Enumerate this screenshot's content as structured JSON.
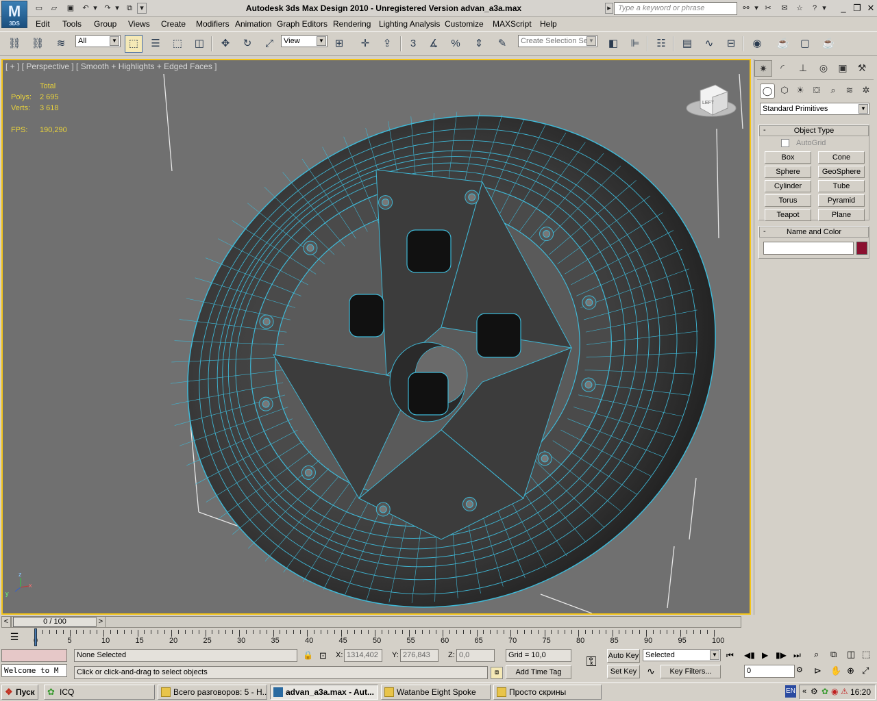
{
  "window": {
    "title": "Autodesk 3ds Max Design 2010    -    Unregistered Version     advan_a3a.max",
    "search_placeholder": "Type a keyword or phrase",
    "logo_text": "3DS"
  },
  "menu": [
    "Edit",
    "Tools",
    "Group",
    "Views",
    "Create",
    "Modifiers",
    "Animation",
    "Graph Editors",
    "Rendering",
    "Lighting Analysis",
    "Customize",
    "MAXScript",
    "Help"
  ],
  "toolbar": {
    "selection_filter": "All",
    "ref_coord": "View",
    "named_selection_placeholder": "Create Selection Se",
    "snap_label": "3",
    "percent_label": "%"
  },
  "viewport": {
    "label": "[ + ] [ Perspective ] [ Smooth + Highlights + Edged Faces ]",
    "stats": {
      "header": "Total",
      "polys_label": "Polys:",
      "polys_value": "2 695",
      "verts_label": "Verts:",
      "verts_value": "3 618",
      "fps_label": "FPS:",
      "fps_value": "190,290"
    },
    "viewcube_label": "LEFT",
    "axis_labels": {
      "z": "z",
      "x": "x",
      "y": "y"
    },
    "colors": {
      "background": "#707070",
      "wire": "#3fb8d6",
      "border": "#f5c518"
    }
  },
  "command_panel": {
    "dropdown": "Standard Primitives",
    "object_type_title": "Object Type",
    "autogrid_label": "AutoGrid",
    "primitives": [
      "Box",
      "Cone",
      "Sphere",
      "GeoSphere",
      "Cylinder",
      "Tube",
      "Torus",
      "Pyramid",
      "Teapot",
      "Plane"
    ],
    "name_color_title": "Name and Color",
    "name_value": "",
    "object_color": "#8b1030"
  },
  "time_slider": {
    "position": "0 / 100",
    "prev": "<",
    "next": ">",
    "ticks": [
      "0",
      "5",
      "10",
      "15",
      "20",
      "25",
      "30",
      "35",
      "40",
      "45",
      "50",
      "55",
      "60",
      "65",
      "70",
      "75",
      "80",
      "85",
      "90",
      "95",
      "100"
    ]
  },
  "status": {
    "maxscript_listener": "Welcome to M",
    "selection": "None Selected",
    "prompt": "Click or click-and-drag to select objects",
    "x_label": "X:",
    "x_value": "1314,402",
    "y_label": "Y:",
    "y_value": "276,843",
    "z_label": "Z:",
    "z_value": "0,0",
    "grid": "Grid = 10,0",
    "add_time_tag": "Add Time Tag",
    "auto_key": "Auto Key",
    "set_key": "Set Key",
    "key_mode": "Selected",
    "key_filters": "Key Filters...",
    "frame": "0"
  },
  "taskbar": {
    "start": "Пуск",
    "tasks": [
      {
        "label": "ICQ",
        "active": false
      },
      {
        "label": "Всего разговоров: 5 - Н...",
        "active": false
      },
      {
        "label": "advan_a3a.max - Aut...",
        "active": true
      },
      {
        "label": "Watanbe Eight Spoke",
        "active": false
      },
      {
        "label": "Просто скрины",
        "active": false
      }
    ],
    "lang": "EN",
    "clock": "16:20"
  }
}
